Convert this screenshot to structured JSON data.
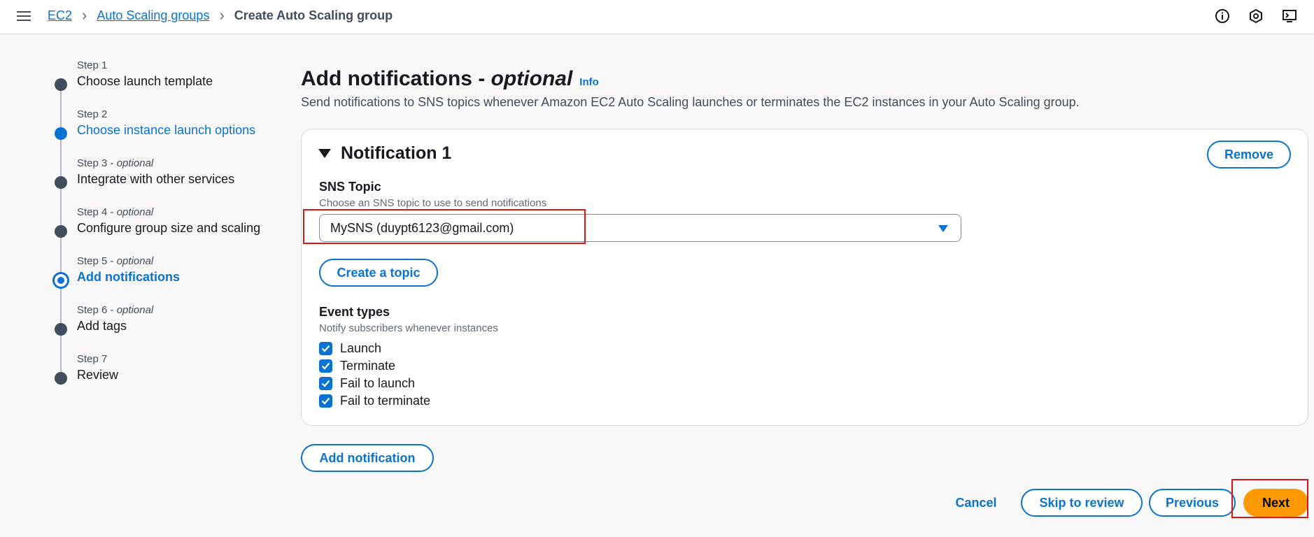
{
  "header": {
    "breadcrumbs": [
      {
        "label": "EC2"
      },
      {
        "label": "Auto Scaling groups"
      },
      {
        "label": "Create Auto Scaling group"
      }
    ],
    "icons": [
      "menu-icon",
      "info-circle-icon",
      "settings-hex-icon",
      "cloudshell-icon"
    ]
  },
  "steps": [
    {
      "num": "Step 1",
      "optional": "",
      "title": "Choose launch template"
    },
    {
      "num": "Step 2",
      "optional": "",
      "title": "Choose instance launch options"
    },
    {
      "num": "Step 3",
      "optional": "optional",
      "title": "Integrate with other services"
    },
    {
      "num": "Step 4",
      "optional": "optional",
      "title": "Configure group size and scaling"
    },
    {
      "num": "Step 5",
      "optional": "optional",
      "title": "Add notifications"
    },
    {
      "num": "Step 6",
      "optional": "optional",
      "title": "Add tags"
    },
    {
      "num": "Step 7",
      "optional": "",
      "title": "Review"
    }
  ],
  "page": {
    "title": "Add notifications - ",
    "title_optional": "optional",
    "info": "Info",
    "description": "Send notifications to SNS topics whenever Amazon EC2 Auto Scaling launches or terminates the EC2 instances in your Auto Scaling group."
  },
  "notification": {
    "title": "Notification 1",
    "remove_label": "Remove",
    "sns_label": "SNS Topic",
    "sns_desc": "Choose an SNS topic to use to send notifications",
    "sns_value": "MySNS (duypt6123@gmail.com)",
    "create_topic_label": "Create a topic",
    "events_label": "Event types",
    "events_desc": "Notify subscribers whenever instances",
    "events": [
      {
        "label": "Launch",
        "checked": true
      },
      {
        "label": "Terminate",
        "checked": true
      },
      {
        "label": "Fail to launch",
        "checked": true
      },
      {
        "label": "Fail to terminate",
        "checked": true
      }
    ]
  },
  "actions": {
    "add_notification": "Add notification",
    "cancel": "Cancel",
    "skip": "Skip to review",
    "previous": "Previous",
    "next": "Next"
  },
  "colors": {
    "accent": "#0972d3",
    "primary_button": "#ff9900",
    "highlight": "#d91515"
  }
}
